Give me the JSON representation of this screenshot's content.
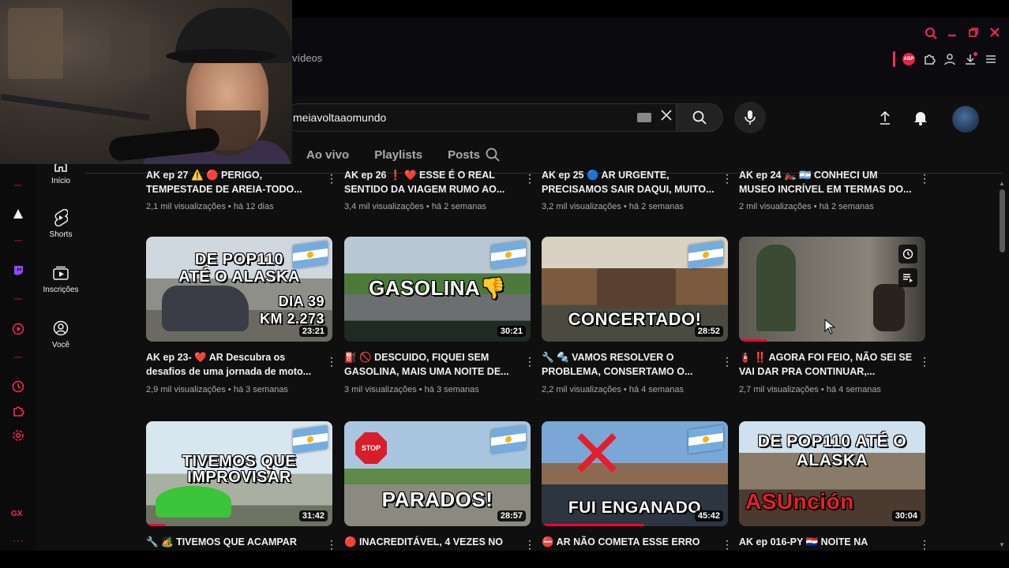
{
  "browser": {
    "tab_text": "vídeos",
    "window_controls": [
      {
        "name": "browser-search-icon",
        "glyph": "⌕"
      },
      {
        "name": "minimize-icon",
        "glyph": "—"
      },
      {
        "name": "restore-icon",
        "glyph": "❐"
      },
      {
        "name": "close-window-icon",
        "glyph": "✕"
      }
    ],
    "accent_color": "#ff2a52"
  },
  "header": {
    "search_value": "meiavoltaaomundo"
  },
  "channel_tabs": [
    {
      "label": "Ao vivo"
    },
    {
      "label": "Playlists"
    },
    {
      "label": "Posts"
    }
  ],
  "guide": [
    {
      "label": "Início",
      "icon": "home-icon"
    },
    {
      "label": "Shorts",
      "icon": "shorts-icon"
    },
    {
      "label": "Inscrições",
      "icon": "subscriptions-icon"
    },
    {
      "label": "Você",
      "icon": "you-icon"
    }
  ],
  "rail": {
    "label": "GX"
  },
  "top_row": [
    {
      "title": "AK ep 27 ⚠️ 🔴 PERIGO, TEMPESTADE DE AREIA-TODO...",
      "meta": "2,1 mil visualizações • há 12 dias"
    },
    {
      "title": "AK ep 26 ❗ ❤️ ESSE É O REAL SENTIDO DA VIAGEM RUMO AO...",
      "meta": "3,4 mil visualizações • há 2 semanas"
    },
    {
      "title": "AK ep 25 🔵 AR URGENTE, PRECISAMOS SAIR DAQUI, MUITO...",
      "meta": "3,2 mil visualizações • há 2 semanas"
    },
    {
      "title": "AK ep 24 🏍️ 🇦🇷 CONHECI UM MUSEO INCRÍVEL EM TERMAS DO...",
      "meta": "2 mil visualizações • há 2 semanas"
    }
  ],
  "middle_row": [
    {
      "thumb_line1": "DE POP110",
      "thumb_line2": "ATÉ O ALASKA",
      "thumb_line3": "DIA 39",
      "thumb_line4": "KM 2.273",
      "duration": "23:21",
      "progress": 0.0,
      "title": "AK ep 23- ❤️ AR Descubra os desafios de uma jornada de moto...",
      "meta": "2,9 mil visualizações • há 3 semanas"
    },
    {
      "thumb_line1": "GASOLINA👎",
      "duration": "30:21",
      "progress": 0.0,
      "title": "⛽ 🚫 DESCUIDO, FIQUEI SEM GASOLINA, MAIS UMA NOITE DE...",
      "meta": "3 mil visualizações • há 3 semanas"
    },
    {
      "thumb_line1": "CONCERTADO!",
      "duration": "28:52",
      "progress": 0.0,
      "title": "🔧 🔩 VAMOS RESOLVER O PROBLEMA, CONSERTAMO O...",
      "meta": "2,2 mil visualizações • há 4 semanas"
    },
    {
      "duration": "",
      "progress": 0.15,
      "title": "🧯 ‼️ AGORA FOI FEIO, NÃO SEI SE VAI DAR PRA CONTINUAR,...",
      "meta": "2,7 mil visualizações • há 4 semanas"
    }
  ],
  "bottom_row": [
    {
      "thumb_line1": "TIVEMOS QUE",
      "thumb_line2": "IMPROVISAR",
      "duration": "31:42",
      "progress": 0.1,
      "title": "🔧 🏕️ TIVEMOS QUE ACAMPAR"
    },
    {
      "thumb_line1": "PARADOS!",
      "stop": "STOP",
      "duration": "28:57",
      "progress": 0.0,
      "title": "🔴 INACREDITÁVEL, 4 VEZES NO"
    },
    {
      "thumb_line1": "FUI ENGANADO",
      "duration": "45:42",
      "progress": 0.55,
      "title": "⛔ AR NÃO COMETA ESSE ERRO AO"
    },
    {
      "thumb_line1": "DE POP110 ATÉ O",
      "thumb_line2": "ALASKA",
      "thumb_line3": "ASUnción",
      "duration": "30:04",
      "progress": 0.0,
      "title": "AK ep 016-PY 🇵🇾 NOITE NA"
    }
  ]
}
